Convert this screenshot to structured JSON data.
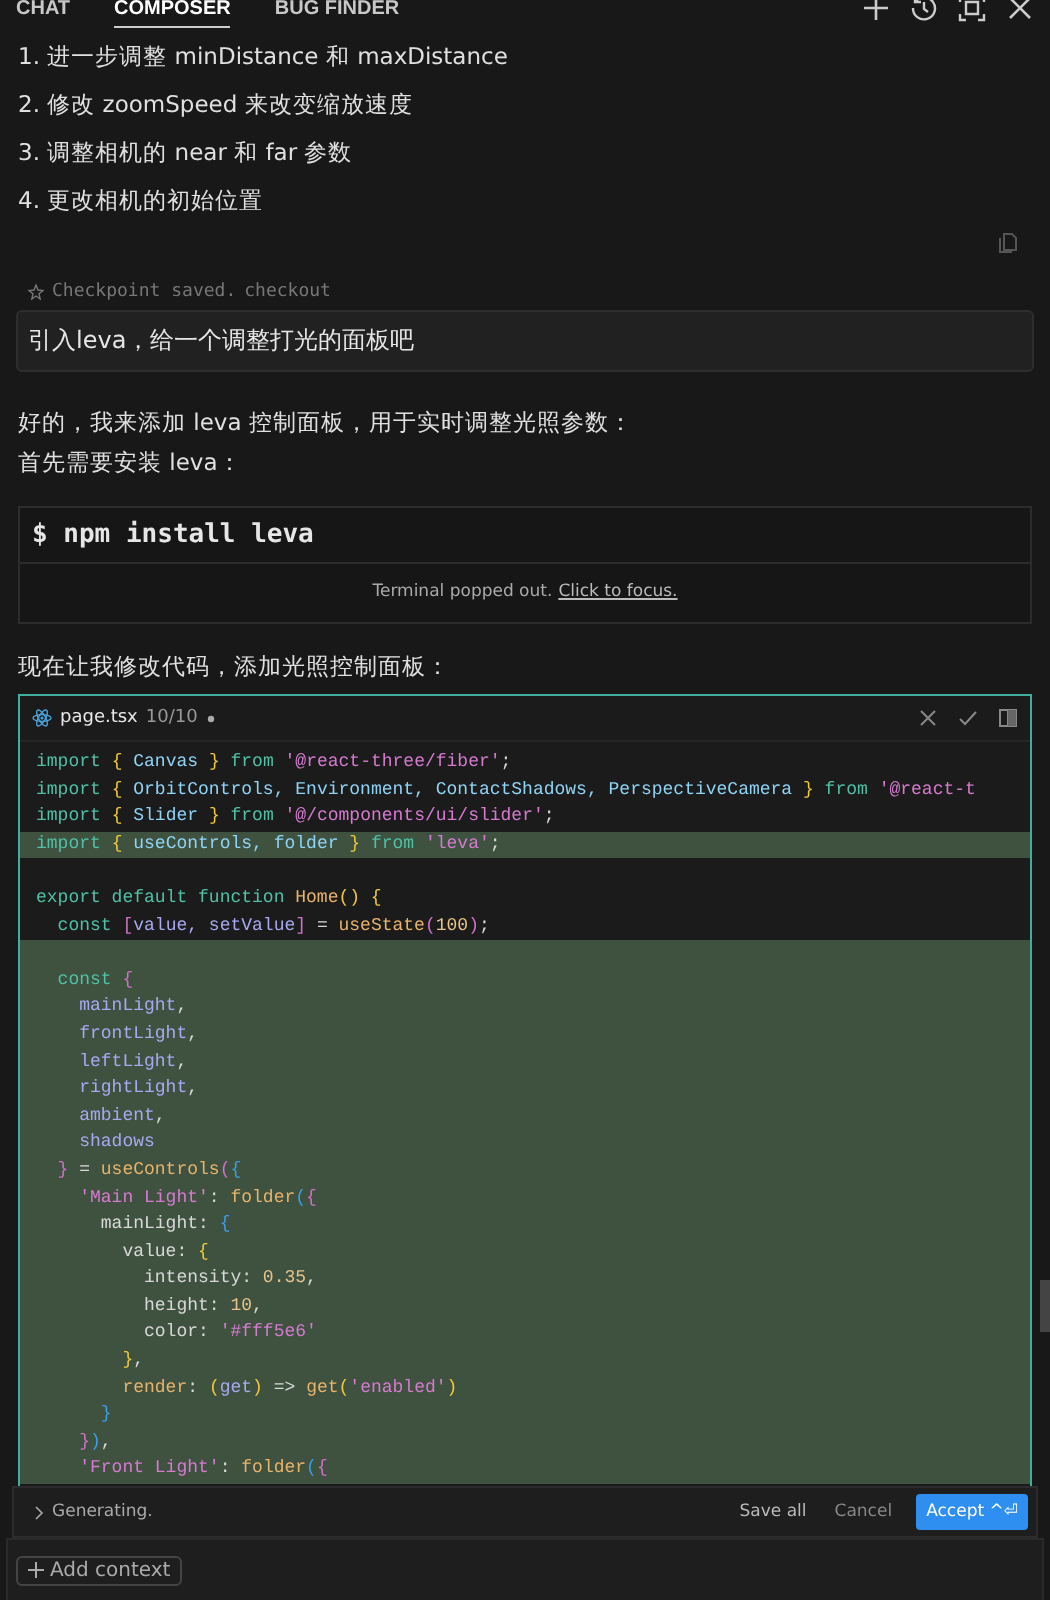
{
  "tabs": [
    {
      "label": "CHAT",
      "selected": false
    },
    {
      "label": "COMPOSER",
      "selected": true
    },
    {
      "label": "BUG FINDER",
      "selected": false
    }
  ],
  "previous_list": [
    "1. 进一步调整 minDistance 和 maxDistance",
    "2. 修改 zoomSpeed 来改变缩放速度",
    "3. 调整相机的 near 和 far 参数",
    "4. 更改相机的初始位置"
  ],
  "checkpoint": {
    "text": "Checkpoint saved.",
    "link": "checkout"
  },
  "user_message": "引入leva，给一个调整打光的面板吧",
  "reply_lines": [
    "好的，我来添加 leva 控制面板，用于实时调整光照参数：",
    "首先需要安装 leva："
  ],
  "terminal": {
    "command": "$ npm install leva",
    "note": "Terminal popped out.",
    "link": "Click to focus."
  },
  "reply_after": "现在让我修改代码，添加光照控制面板：",
  "editor": {
    "filename": "page.tsx",
    "counter": "10/10",
    "unsaved": true,
    "lines": [
      {
        "highlighted": false,
        "tokens": [
          {
            "kind": "kw",
            "text": "import "
          },
          {
            "kind": "br",
            "text": "{ "
          },
          {
            "kind": "id",
            "text": "Canvas "
          },
          {
            "kind": "br",
            "text": "} "
          },
          {
            "kind": "kw",
            "text": "from "
          },
          {
            "kind": "str",
            "text": "'@react-three/fiber'"
          },
          {
            "kind": "p",
            "text": ";"
          }
        ]
      },
      {
        "highlighted": false,
        "tokens": [
          {
            "kind": "kw",
            "text": "import "
          },
          {
            "kind": "br",
            "text": "{ "
          },
          {
            "kind": "id",
            "text": "OrbitControls, Environment, ContactShadows, PerspectiveCamera "
          },
          {
            "kind": "br",
            "text": "} "
          },
          {
            "kind": "kw",
            "text": "from "
          },
          {
            "kind": "str",
            "text": "'@react-t"
          }
        ]
      },
      {
        "highlighted": false,
        "tokens": [
          {
            "kind": "kw",
            "text": "import "
          },
          {
            "kind": "br",
            "text": "{ "
          },
          {
            "kind": "id",
            "text": "Slider "
          },
          {
            "kind": "br",
            "text": "} "
          },
          {
            "kind": "kw",
            "text": "from "
          },
          {
            "kind": "str",
            "text": "'@/components/ui/slider'"
          },
          {
            "kind": "p",
            "text": ";"
          }
        ]
      },
      {
        "highlighted": true,
        "tokens": [
          {
            "kind": "kw",
            "text": "import "
          },
          {
            "kind": "br",
            "text": "{ "
          },
          {
            "kind": "id",
            "text": "useControls, folder "
          },
          {
            "kind": "br",
            "text": "} "
          },
          {
            "kind": "kw",
            "text": "from "
          },
          {
            "kind": "str",
            "text": "'leva'"
          },
          {
            "kind": "p",
            "text": ";"
          }
        ]
      },
      {
        "highlighted": false
      },
      {
        "highlighted": false,
        "tokens": [
          {
            "kind": "kw",
            "text": "export default function "
          },
          {
            "kind": "fn",
            "text": "Home"
          },
          {
            "kind": "br",
            "text": "() {"
          }
        ]
      },
      {
        "highlighted": false,
        "tokens": [
          {
            "kind": "kw",
            "text": "  const "
          },
          {
            "kind": "br2",
            "text": "["
          },
          {
            "kind": "var",
            "text": "value, setValue"
          },
          {
            "kind": "br2",
            "text": "]"
          },
          {
            "kind": "p",
            "text": " = "
          },
          {
            "kind": "fn",
            "text": "useState"
          },
          {
            "kind": "br2",
            "text": "("
          },
          {
            "kind": "num",
            "text": "100"
          },
          {
            "kind": "br2",
            "text": ")"
          },
          {
            "kind": "p",
            "text": ";"
          }
        ]
      },
      {
        "highlighted": true
      },
      {
        "highlighted": true,
        "tokens": [
          {
            "kind": "kw",
            "text": "  const "
          },
          {
            "kind": "br2",
            "text": "{"
          }
        ]
      },
      {
        "highlighted": true,
        "tokens": [
          {
            "kind": "var",
            "text": "    mainLight"
          },
          {
            "kind": "p",
            "text": ","
          }
        ]
      },
      {
        "highlighted": true,
        "tokens": [
          {
            "kind": "var",
            "text": "    frontLight"
          },
          {
            "kind": "p",
            "text": ","
          }
        ]
      },
      {
        "highlighted": true,
        "tokens": [
          {
            "kind": "var",
            "text": "    leftLight"
          },
          {
            "kind": "p",
            "text": ","
          }
        ]
      },
      {
        "highlighted": true,
        "tokens": [
          {
            "kind": "var",
            "text": "    rightLight"
          },
          {
            "kind": "p",
            "text": ","
          }
        ]
      },
      {
        "highlighted": true,
        "tokens": [
          {
            "kind": "var",
            "text": "    ambient"
          },
          {
            "kind": "p",
            "text": ","
          }
        ]
      },
      {
        "highlighted": true,
        "tokens": [
          {
            "kind": "var",
            "text": "    shadows"
          }
        ]
      },
      {
        "highlighted": true,
        "tokens": [
          {
            "kind": "br2",
            "text": "  }"
          },
          {
            "kind": "p",
            "text": " = "
          },
          {
            "kind": "fn",
            "text": "useControls"
          },
          {
            "kind": "br2",
            "text": "("
          },
          {
            "kind": "br3",
            "text": "{"
          }
        ]
      },
      {
        "highlighted": true,
        "tokens": [
          {
            "kind": "str",
            "text": "    'Main Light'"
          },
          {
            "kind": "p",
            "text": ": "
          },
          {
            "kind": "fn",
            "text": "folder"
          },
          {
            "kind": "br3",
            "text": "("
          },
          {
            "kind": "br2",
            "text": "{"
          }
        ]
      },
      {
        "highlighted": true,
        "tokens": [
          {
            "kind": "p",
            "text": "      mainLight: "
          },
          {
            "kind": "br3",
            "text": "{"
          }
        ]
      },
      {
        "highlighted": true,
        "tokens": [
          {
            "kind": "p",
            "text": "        value: "
          },
          {
            "kind": "br",
            "text": "{"
          }
        ]
      },
      {
        "highlighted": true,
        "tokens": [
          {
            "kind": "p",
            "text": "          intensity: "
          },
          {
            "kind": "num",
            "text": "0.35"
          },
          {
            "kind": "p",
            "text": ","
          }
        ]
      },
      {
        "highlighted": true,
        "tokens": [
          {
            "kind": "p",
            "text": "          height: "
          },
          {
            "kind": "num",
            "text": "10"
          },
          {
            "kind": "p",
            "text": ","
          }
        ]
      },
      {
        "highlighted": true,
        "tokens": [
          {
            "kind": "p",
            "text": "          color: "
          },
          {
            "kind": "str",
            "text": "'#fff5e6'"
          }
        ]
      },
      {
        "highlighted": true,
        "tokens": [
          {
            "kind": "br",
            "text": "        }"
          },
          {
            "kind": "p",
            "text": ","
          }
        ]
      },
      {
        "highlighted": true,
        "tokens": [
          {
            "kind": "fn",
            "text": "        render"
          },
          {
            "kind": "p",
            "text": ": "
          },
          {
            "kind": "br",
            "text": "("
          },
          {
            "kind": "var",
            "text": "get"
          },
          {
            "kind": "br",
            "text": ")"
          },
          {
            "kind": "p",
            "text": " => "
          },
          {
            "kind": "fn",
            "text": "get"
          },
          {
            "kind": "br",
            "text": "("
          },
          {
            "kind": "str",
            "text": "'enabled'"
          },
          {
            "kind": "br",
            "text": ")"
          }
        ]
      },
      {
        "highlighted": true,
        "tokens": [
          {
            "kind": "br3",
            "text": "      }"
          }
        ]
      },
      {
        "highlighted": true,
        "tokens": [
          {
            "kind": "br2",
            "text": "    }"
          },
          {
            "kind": "br3",
            "text": ")"
          },
          {
            "kind": "p",
            "text": ","
          }
        ]
      },
      {
        "highlighted": true,
        "tokens": [
          {
            "kind": "str",
            "text": "    'Front Light'"
          },
          {
            "kind": "p",
            "text": ": "
          },
          {
            "kind": "fn",
            "text": "folder"
          },
          {
            "kind": "br3",
            "text": "("
          },
          {
            "kind": "br2",
            "text": "{"
          }
        ]
      }
    ]
  },
  "status_bar": {
    "status": "Generating.",
    "buttons": [
      {
        "label": "Save all",
        "kind": "plain"
      },
      {
        "label": "Cancel",
        "kind": "muted"
      },
      {
        "label": "Accept ^⏎",
        "kind": "primary"
      }
    ]
  },
  "add_context": "Add context"
}
